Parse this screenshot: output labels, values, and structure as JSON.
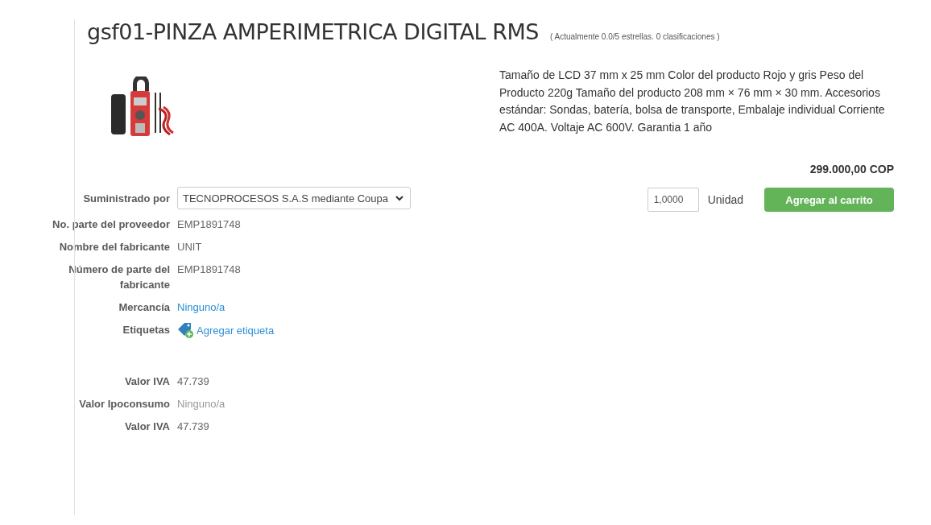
{
  "title": "gsf01-PINZA AMPERIMETRICA DIGITAL RMS",
  "rating_note": "( Actualmente 0.0/5 estrellas. 0 clasificaciones )",
  "description": "Tamaño de LCD 37 mm x 25 mm Color del producto Rojo y gris Peso del Producto 220g Tamaño del producto 208 mm × 76 mm × 30 mm. Accesorios estándar: Sondas, batería, bolsa de transporte, Embalaje individual Corriente AC 400A. Voltaje AC 600V. Garantia 1 año",
  "price": "299.000,00 COP",
  "quantity": {
    "value": "1,0000",
    "unit": "Unidad"
  },
  "add_button": "Agregar al carrito",
  "details": [
    {
      "kind": "select",
      "label": "Suministrado por",
      "value": "TECNOPROCESOS S.A.S mediante Coupa"
    },
    {
      "kind": "text",
      "label": "No. parte del proveedor",
      "value": "EMP1891748"
    },
    {
      "kind": "text",
      "label": "Nombre del fabricante",
      "value": "UNIT"
    },
    {
      "kind": "text",
      "label": "Número de parte del fabricante",
      "value": "EMP1891748"
    },
    {
      "kind": "link",
      "label": "Mercancía",
      "value": "Ninguno/a"
    },
    {
      "kind": "tag",
      "label": "Etiquetas",
      "value": "Agregar etiqueta"
    },
    {
      "kind": "spacer"
    },
    {
      "kind": "text",
      "label": "Valor IVA",
      "value": "47.739"
    },
    {
      "kind": "muted",
      "label": "Valor Ipoconsumo",
      "value": "Ninguno/a"
    },
    {
      "kind": "text",
      "label": "Valor IVA",
      "value": "47.739"
    }
  ]
}
